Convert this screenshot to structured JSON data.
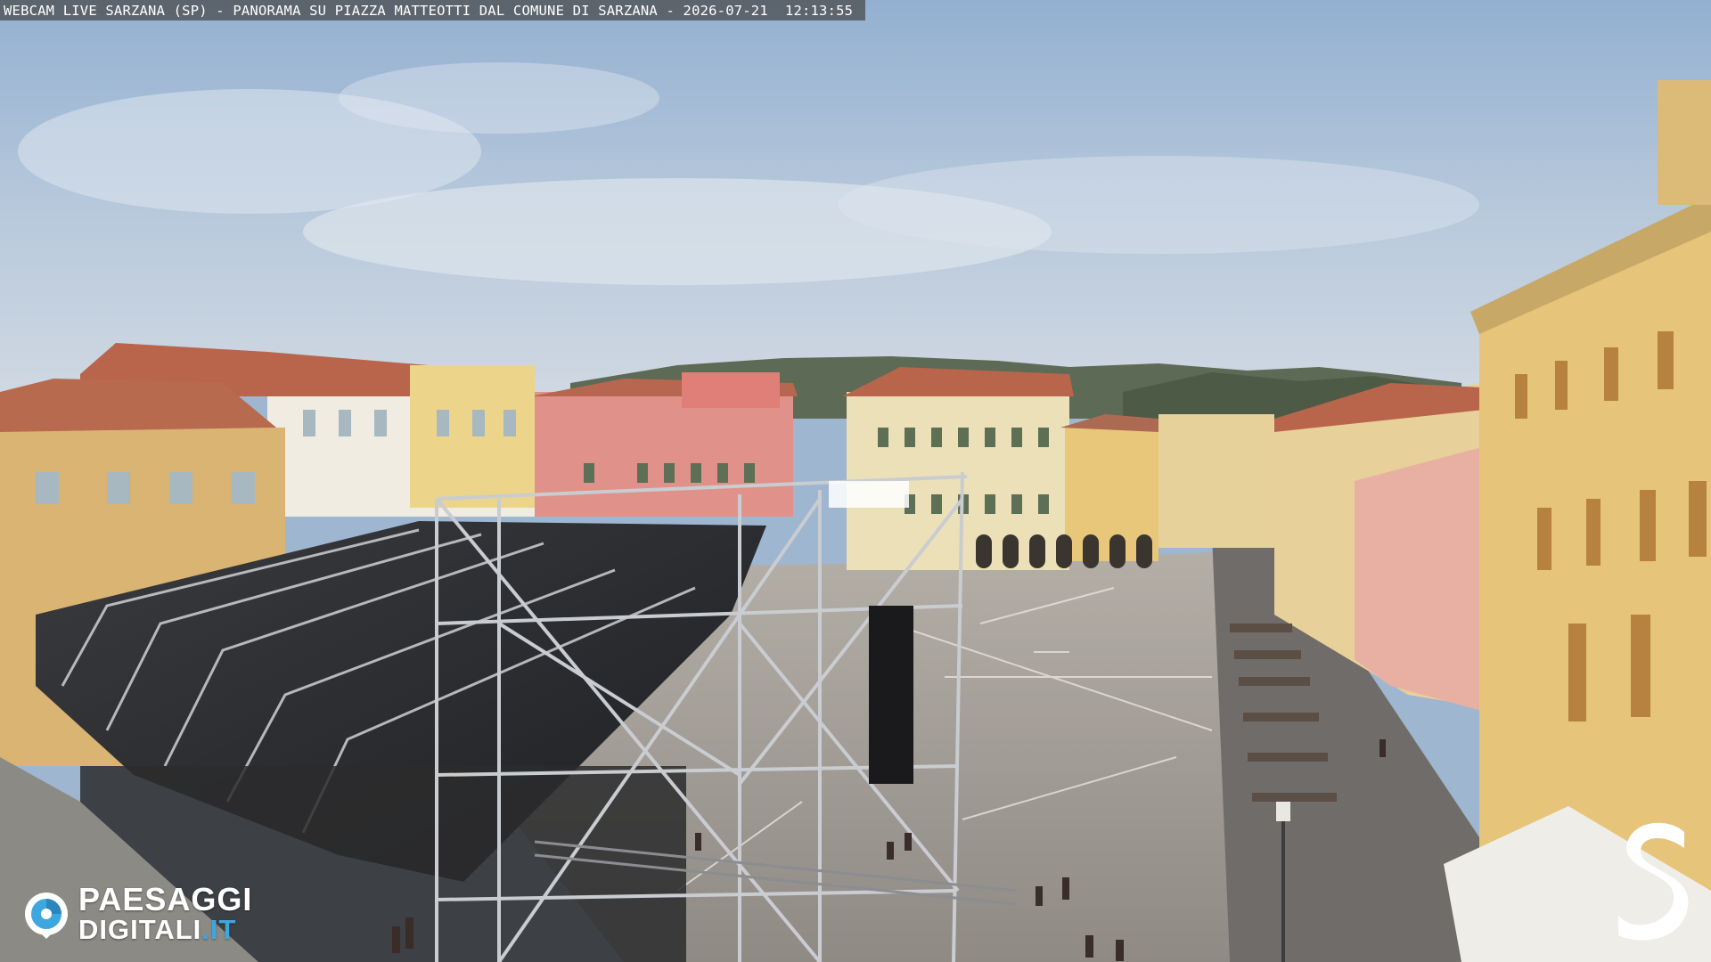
{
  "caption": {
    "text": "WEBCAM LIVE SARZANA (SP) - PANORAMA SU PIAZZA MATTEOTTI DAL COMUNE DI SARZANA - 2026-07-21  12:13:55"
  },
  "logo": {
    "line1": "PAESAGGI",
    "line2_main": "DIGITALI",
    "line2_suffix": ".IT",
    "accent_color": "#3fa7e0"
  },
  "brand_mark": {
    "icon": "s-brand-icon",
    "color": "#ffffff"
  },
  "colors": {
    "sky": "#a9bfd8",
    "square_pavement": "#a7a29b",
    "stage_cover": "#2a2b2e",
    "building_yellow": "#e0c47c",
    "building_pink": "#e49088",
    "roof_tiles": "#b8654c"
  }
}
